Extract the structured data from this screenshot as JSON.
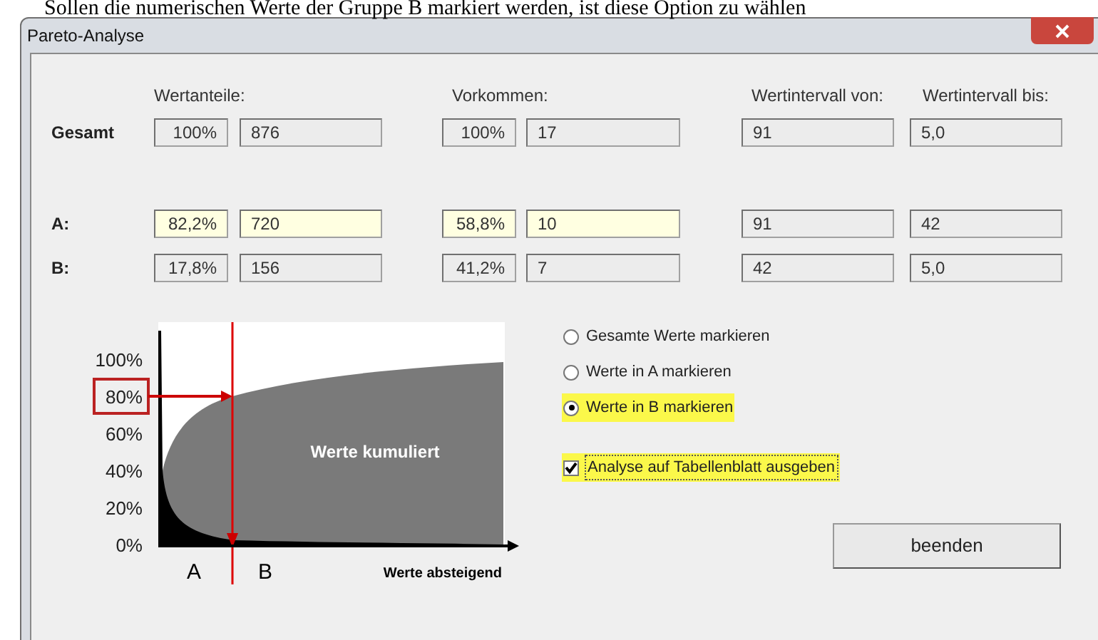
{
  "caption": "Sollen die numerischen Werte der Gruppe B markiert werden, ist diese Option zu wählen",
  "window": {
    "title": "Pareto-Analyse"
  },
  "headers": [
    "Wertanteile:",
    "Vorkommen:",
    "Wertintervall von:",
    "Wertintervall bis:"
  ],
  "rows": [
    {
      "label": "Gesamt",
      "cells": [
        {
          "value": "100%",
          "highlighted": false
        },
        {
          "value": "876",
          "highlighted": false
        },
        {
          "value": "100%",
          "highlighted": false
        },
        {
          "value": "17",
          "highlighted": false
        },
        {
          "value": "91",
          "highlighted": false
        },
        {
          "value": "5,0",
          "highlighted": false
        }
      ]
    },
    {
      "label": "A:",
      "cells": [
        {
          "value": "82,2%",
          "highlighted": true
        },
        {
          "value": "720",
          "highlighted": true
        },
        {
          "value": "58,8%",
          "highlighted": true
        },
        {
          "value": "10",
          "highlighted": true
        },
        {
          "value": "91",
          "highlighted": false
        },
        {
          "value": "42",
          "highlighted": false
        }
      ]
    },
    {
      "label": "B:",
      "cells": [
        {
          "value": "17,8%",
          "highlighted": false
        },
        {
          "value": "156",
          "highlighted": false
        },
        {
          "value": "41,2%",
          "highlighted": false
        },
        {
          "value": "7",
          "highlighted": false
        },
        {
          "value": "42",
          "highlighted": false
        },
        {
          "value": "5,0",
          "highlighted": false
        }
      ]
    }
  ],
  "diagram": {
    "yticks": [
      {
        "label": "100%",
        "highlighted": false
      },
      {
        "label": "80%",
        "highlighted": true
      },
      {
        "label": "60%",
        "highlighted": false
      },
      {
        "label": "40%",
        "highlighted": false
      },
      {
        "label": "20%",
        "highlighted": false
      },
      {
        "label": "0%",
        "highlighted": false
      }
    ],
    "area_label": "Werte kumuliert",
    "region_a": "A",
    "region_b": "B",
    "xlabel": "Werte absteigend"
  },
  "options": [
    {
      "label": "Gesamte Werte markieren",
      "selected": false,
      "highlighted": false
    },
    {
      "label": "Werte in A markieren",
      "selected": false,
      "highlighted": false
    },
    {
      "label": "Werte in B markieren",
      "selected": true,
      "highlighted": true
    }
  ],
  "export_checkbox": {
    "label": "Analyse auf Tabellenblatt ausgeben",
    "checked": true,
    "highlighted": true
  },
  "buttons": [
    "beenden"
  ]
}
